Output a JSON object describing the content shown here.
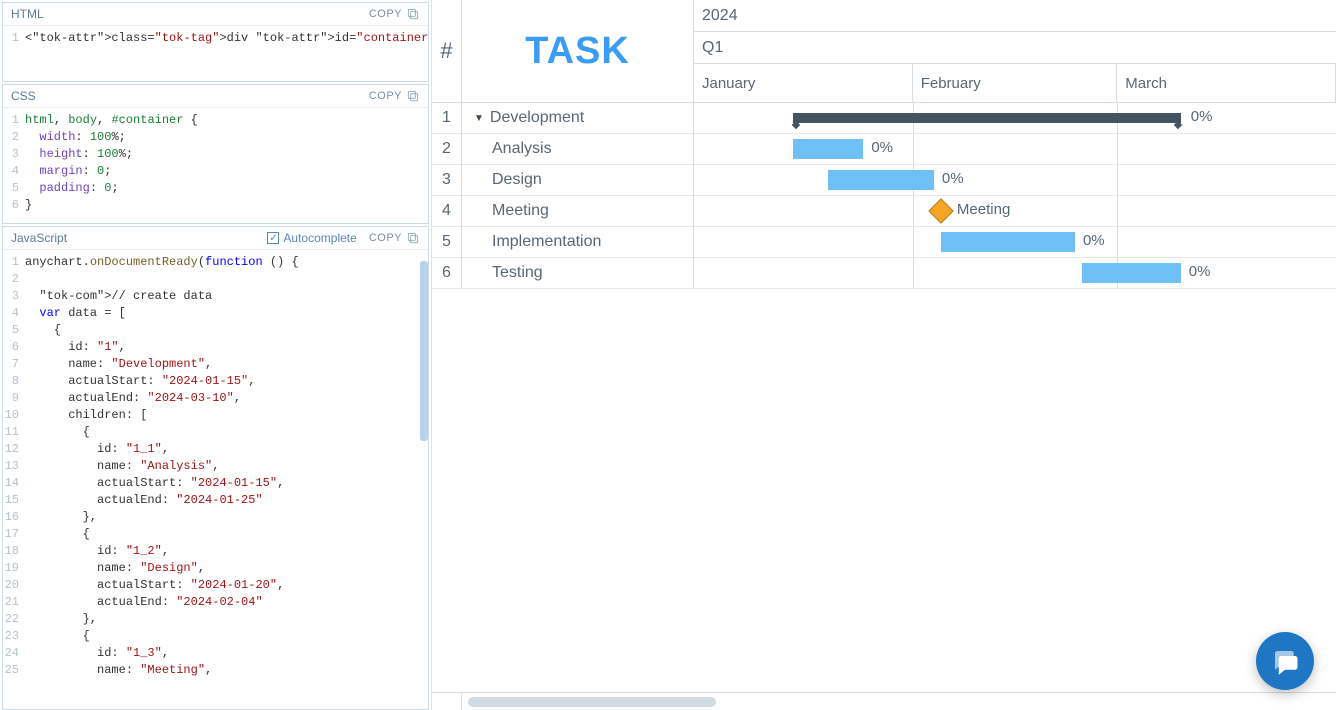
{
  "chart_data": {
    "type": "gantt",
    "year": "2024",
    "quarter": "Q1",
    "months": [
      "January",
      "February",
      "March"
    ],
    "timeline_start": "2024-01-01",
    "timeline_end": "2024-03-31",
    "tasks": [
      {
        "num": 1,
        "name": "Development",
        "type": "parent",
        "start": "2024-01-15",
        "end": "2024-03-10",
        "progress": "0%"
      },
      {
        "num": 2,
        "name": "Analysis",
        "type": "child",
        "start": "2024-01-15",
        "end": "2024-01-25",
        "progress": "0%"
      },
      {
        "num": 3,
        "name": "Design",
        "type": "child",
        "start": "2024-01-20",
        "end": "2024-02-04",
        "progress": "0%"
      },
      {
        "num": 4,
        "name": "Meeting",
        "type": "milestone",
        "date": "2024-02-05",
        "label": "Meeting"
      },
      {
        "num": 5,
        "name": "Implementation",
        "type": "child",
        "start": "2024-02-05",
        "end": "2024-02-24",
        "progress": "0%"
      },
      {
        "num": 6,
        "name": "Testing",
        "type": "child",
        "start": "2024-02-25",
        "end": "2024-03-10",
        "progress": "0%"
      }
    ]
  },
  "panels": {
    "html": {
      "title": "HTML",
      "copy": "COPY"
    },
    "css": {
      "title": "CSS",
      "copy": "COPY"
    },
    "js": {
      "title": "JavaScript",
      "copy": "COPY",
      "autocomplete": "Autocomplete"
    }
  },
  "code": {
    "html": [
      "<div id=\"container\"></div>"
    ],
    "css": [
      "html, body, #container {",
      "  width: 100%;",
      "  height: 100%;",
      "  margin: 0;",
      "  padding: 0;",
      "}"
    ],
    "js": [
      "anychart.onDocumentReady(function () {",
      "",
      "  // create data",
      "  var data = [",
      "    {",
      "      id: \"1\",",
      "      name: \"Development\",",
      "      actualStart: \"2024-01-15\",",
      "      actualEnd: \"2024-03-10\",",
      "      children: [",
      "        {",
      "          id: \"1_1\",",
      "          name: \"Analysis\",",
      "          actualStart: \"2024-01-15\",",
      "          actualEnd: \"2024-01-25\"",
      "        },",
      "        {",
      "          id: \"1_2\",",
      "          name: \"Design\",",
      "          actualStart: \"2024-01-20\",",
      "          actualEnd: \"2024-02-04\"",
      "        },",
      "        {",
      "          id: \"1_3\",",
      "          name: \"Meeting\","
    ]
  },
  "header": {
    "num": "#",
    "task": "TASK"
  }
}
